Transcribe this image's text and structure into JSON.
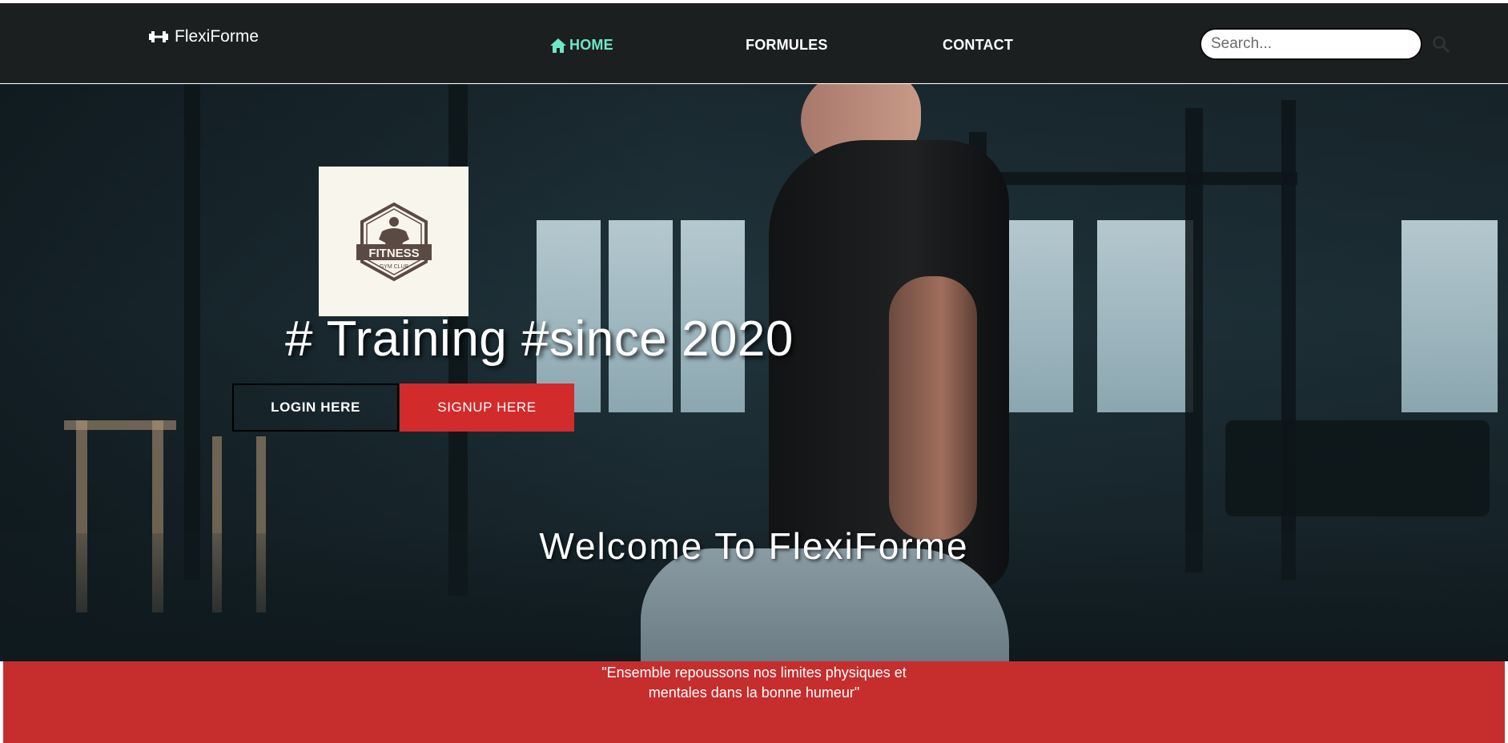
{
  "navbar": {
    "brand": "FlexiForme",
    "links": [
      {
        "label": "HOME",
        "active": true
      },
      {
        "label": "FORMULES",
        "active": false
      },
      {
        "label": "CONTACT",
        "active": false
      }
    ],
    "search_placeholder": "Search..."
  },
  "hero": {
    "logo": {
      "text": "FITNESS",
      "subtext": "GYM CLUB"
    },
    "title": "# Training #since 2020",
    "login_label": "LOGIN HERE",
    "signup_label": "SIGNUP HERE",
    "welcome": "Welcome To FlexiForme"
  },
  "quote": {
    "line1": "\"Ensemble repoussons nos limites physiques et",
    "line2": "mentales dans la bonne humeur\""
  },
  "colors": {
    "navbar_bg": "#1c1f20",
    "active_link": "#6ee7c8",
    "accent_red": "#c62d2d",
    "signup_red": "#d12b2b"
  },
  "icons": {
    "brand": "dumbbell-icon",
    "home": "home-icon",
    "search": "search-icon"
  }
}
